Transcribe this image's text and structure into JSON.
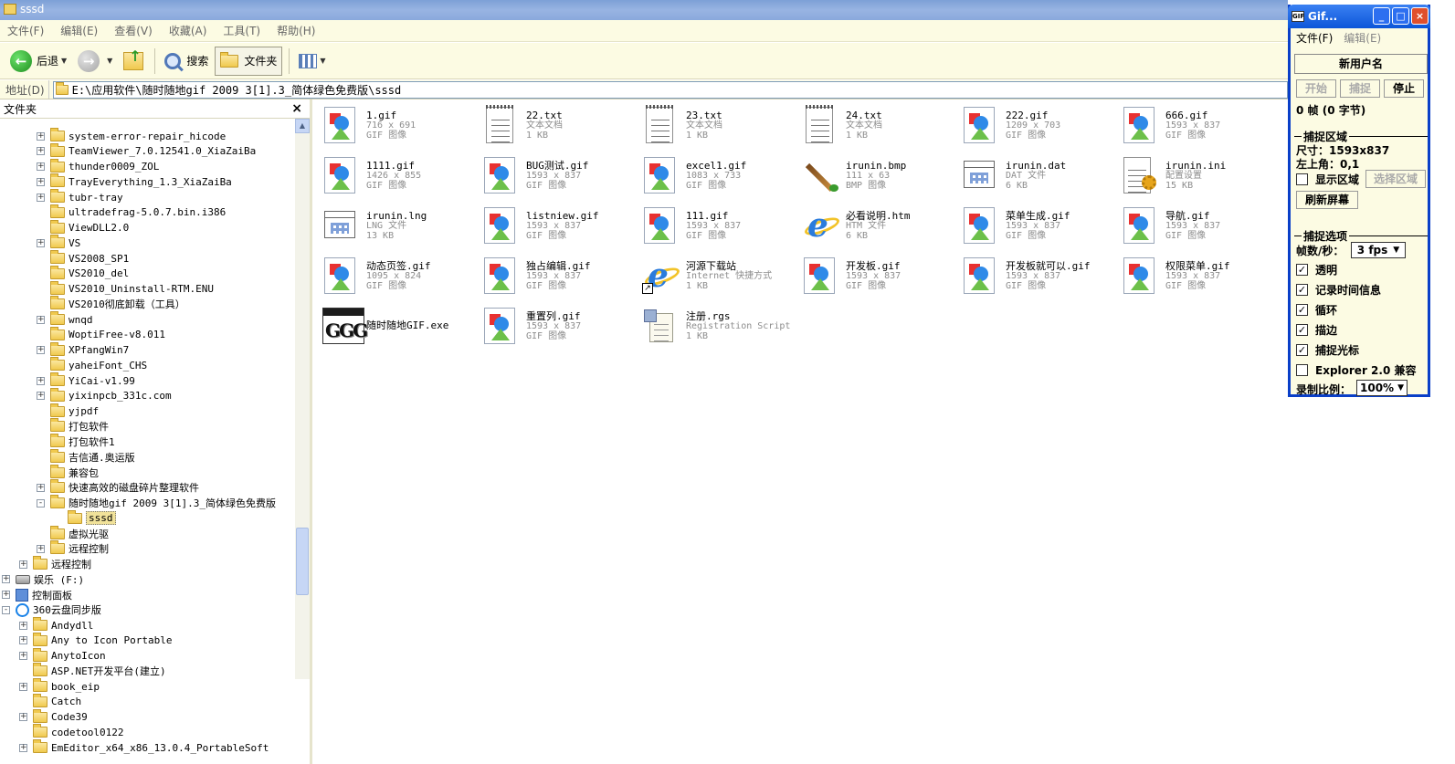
{
  "explorer": {
    "title": "sssd",
    "menu": [
      "文件(F)",
      "编辑(E)",
      "查看(V)",
      "收藏(A)",
      "工具(T)",
      "帮助(H)"
    ],
    "toolbar": {
      "back": "后退",
      "search": "搜索",
      "folders": "文件夹"
    },
    "address": {
      "label": "地址(D)",
      "path": "E:\\应用软件\\随时随地gif 2009 3[1].3_简体绿色免费版\\sssd"
    },
    "folder_pane": {
      "title": "文件夹",
      "close": "×",
      "tree": [
        {
          "label": "system-error-repair_hicode",
          "indent": 2,
          "exp": "+"
        },
        {
          "label": "TeamViewer_7.0.12541.0_XiaZaiBa",
          "indent": 2,
          "exp": "+"
        },
        {
          "label": "thunder0009_ZOL",
          "indent": 2,
          "exp": "+"
        },
        {
          "label": "TrayEverything_1.3_XiaZaiBa",
          "indent": 2,
          "exp": "+"
        },
        {
          "label": "tubr-tray",
          "indent": 2,
          "exp": "+"
        },
        {
          "label": "ultradefrag-5.0.7.bin.i386",
          "indent": 2,
          "exp": ""
        },
        {
          "label": "ViewDLL2.0",
          "indent": 2,
          "exp": ""
        },
        {
          "label": "VS",
          "indent": 2,
          "exp": "+"
        },
        {
          "label": "VS2008_SP1",
          "indent": 2,
          "exp": ""
        },
        {
          "label": "VS2010_del",
          "indent": 2,
          "exp": ""
        },
        {
          "label": "VS2010_Uninstall-RTM.ENU",
          "indent": 2,
          "exp": ""
        },
        {
          "label": "VS2010彻底卸载（工具）",
          "indent": 2,
          "exp": ""
        },
        {
          "label": "wnqd",
          "indent": 2,
          "exp": "+"
        },
        {
          "label": "WoptiFree-v8.011",
          "indent": 2,
          "exp": ""
        },
        {
          "label": "XPfangWin7",
          "indent": 2,
          "exp": "+"
        },
        {
          "label": "yaheiFont_CHS",
          "indent": 2,
          "exp": ""
        },
        {
          "label": "YiCai-v1.99",
          "indent": 2,
          "exp": "+"
        },
        {
          "label": "yixinpcb_331c.com",
          "indent": 2,
          "exp": "+"
        },
        {
          "label": "yjpdf",
          "indent": 2,
          "exp": ""
        },
        {
          "label": "打包软件",
          "indent": 2,
          "exp": ""
        },
        {
          "label": "打包软件1",
          "indent": 2,
          "exp": ""
        },
        {
          "label": "吉信通.奥运版",
          "indent": 2,
          "exp": ""
        },
        {
          "label": "兼容包",
          "indent": 2,
          "exp": ""
        },
        {
          "label": "快速高效的磁盘碎片整理软件",
          "indent": 2,
          "exp": "+"
        },
        {
          "label": "随时随地gif 2009 3[1].3_简体绿色免费版",
          "indent": 2,
          "exp": "-"
        },
        {
          "label": "sssd",
          "indent": 3,
          "exp": "",
          "selected": true
        },
        {
          "label": "虚拟光驱",
          "indent": 2,
          "exp": ""
        },
        {
          "label": "远程控制",
          "indent": 2,
          "exp": "+"
        },
        {
          "label": "远程控制",
          "indent": 1,
          "exp": "+"
        },
        {
          "label": "娱乐 (F:)",
          "indent": 0,
          "exp": "+",
          "type": "drive"
        },
        {
          "label": "控制面板",
          "indent": 0,
          "exp": "+",
          "type": "cp"
        },
        {
          "label": "360云盘同步版",
          "indent": 0,
          "exp": "-",
          "type": "cloud"
        },
        {
          "label": "Andydll",
          "indent": 1,
          "exp": "+"
        },
        {
          "label": "Any to Icon Portable",
          "indent": 1,
          "exp": "+"
        },
        {
          "label": "AnytoIcon",
          "indent": 1,
          "exp": "+"
        },
        {
          "label": "ASP.NET开发平台(建立)",
          "indent": 1,
          "exp": ""
        },
        {
          "label": "book_eip",
          "indent": 1,
          "exp": "+"
        },
        {
          "label": "Catch",
          "indent": 1,
          "exp": ""
        },
        {
          "label": "Code39",
          "indent": 1,
          "exp": "+"
        },
        {
          "label": "codetool0122",
          "indent": 1,
          "exp": ""
        },
        {
          "label": "EmEditor_x64_x86_13.0.4_PortableSoft",
          "indent": 1,
          "exp": "+"
        }
      ]
    },
    "files": [
      {
        "name": "1.gif",
        "l1": "716 x 691",
        "l2": "GIF 图像",
        "icon": "gif"
      },
      {
        "name": "22.txt",
        "l1": "文本文档",
        "l2": "1 KB",
        "icon": "txt"
      },
      {
        "name": "23.txt",
        "l1": "文本文档",
        "l2": "1 KB",
        "icon": "txt"
      },
      {
        "name": "24.txt",
        "l1": "文本文档",
        "l2": "1 KB",
        "icon": "txt"
      },
      {
        "name": "222.gif",
        "l1": "1209 x 703",
        "l2": "GIF 图像",
        "icon": "gif"
      },
      {
        "name": "666.gif",
        "l1": "1593 x 837",
        "l2": "GIF 图像",
        "icon": "gif"
      },
      {
        "name": "1111.gif",
        "l1": "1426 x 855",
        "l2": "GIF 图像",
        "icon": "gif"
      },
      {
        "name": "BUG测试.gif",
        "l1": "1593 x 837",
        "l2": "GIF 图像",
        "icon": "gif"
      },
      {
        "name": "excel1.gif",
        "l1": "1083 x 733",
        "l2": "GIF 图像",
        "icon": "gif"
      },
      {
        "name": "irunin.bmp",
        "l1": "111 x 63",
        "l2": "BMP 图像",
        "icon": "bmp"
      },
      {
        "name": "irunin.dat",
        "l1": "DAT 文件",
        "l2": "6 KB",
        "icon": "win"
      },
      {
        "name": "irunin.ini",
        "l1": "配置设置",
        "l2": "15 KB",
        "icon": "ini"
      },
      {
        "name": "irunin.lng",
        "l1": "LNG 文件",
        "l2": "13 KB",
        "icon": "win"
      },
      {
        "name": "listniew.gif",
        "l1": "1593 x 837",
        "l2": "GIF 图像",
        "icon": "gif"
      },
      {
        "name": "111.gif",
        "l1": "1593 x 837",
        "l2": "GIF 图像",
        "icon": "gif"
      },
      {
        "name": "必看说明.htm",
        "l1": "HTM 文件",
        "l2": "6 KB",
        "icon": "ie"
      },
      {
        "name": "菜单生成.gif",
        "l1": "1593 x 837",
        "l2": "GIF 图像",
        "icon": "gif"
      },
      {
        "name": "导航.gif",
        "l1": "1593 x 837",
        "l2": "GIF 图像",
        "icon": "gif"
      },
      {
        "name": "动态页签.gif",
        "l1": "1095 x 824",
        "l2": "GIF 图像",
        "icon": "gif"
      },
      {
        "name": "独占编辑.gif",
        "l1": "1593 x 837",
        "l2": "GIF 图像",
        "icon": "gif"
      },
      {
        "name": "河源下载站",
        "l1": "Internet 快捷方式",
        "l2": "1 KB",
        "icon": "ie-link"
      },
      {
        "name": "开发板.gif",
        "l1": "1593 x 837",
        "l2": "GIF 图像",
        "icon": "gif"
      },
      {
        "name": "开发板就可以.gif",
        "l1": "1593 x 837",
        "l2": "GIF 图像",
        "icon": "gif"
      },
      {
        "name": "权限菜单.gif",
        "l1": "1593 x 837",
        "l2": "GIF 图像",
        "icon": "gif"
      },
      {
        "name": "随时随地GIF.exe",
        "l1": "",
        "l2": "",
        "icon": "exe"
      },
      {
        "name": "重置列.gif",
        "l1": "1593 x 837",
        "l2": "GIF 图像",
        "icon": "gif"
      },
      {
        "name": "注册.rgs",
        "l1": "Registration Script",
        "l2": "1 KB",
        "icon": "rgs"
      }
    ]
  },
  "giftool": {
    "title": "Gif...",
    "menu_file": "文件(F)",
    "menu_edit": "编辑(E)",
    "username": "新用户名",
    "btn_start": "开始",
    "btn_capture": "捕捉",
    "btn_stop": "停止",
    "frames": "0 帧 (0 字节)",
    "section_area": "捕捉区域",
    "size": "尺寸：1593x837",
    "topleft": "左上角：0,1",
    "show_area": "显示区域",
    "select_area": "选择区域",
    "refresh": "刷新屏幕",
    "section_options": "捕捉选项",
    "fps_label": "帧数/秒：",
    "fps_value": "3 fps",
    "opt_transparent": "透明",
    "opt_timeinfo": "记录时间信息",
    "opt_loop": "循环",
    "opt_border": "描边",
    "opt_cursor": "捕捉光标",
    "opt_explorer": "Explorer 2.0 兼容",
    "scale_label": "录制比例：",
    "scale_value": "100%",
    "check": "✓"
  }
}
